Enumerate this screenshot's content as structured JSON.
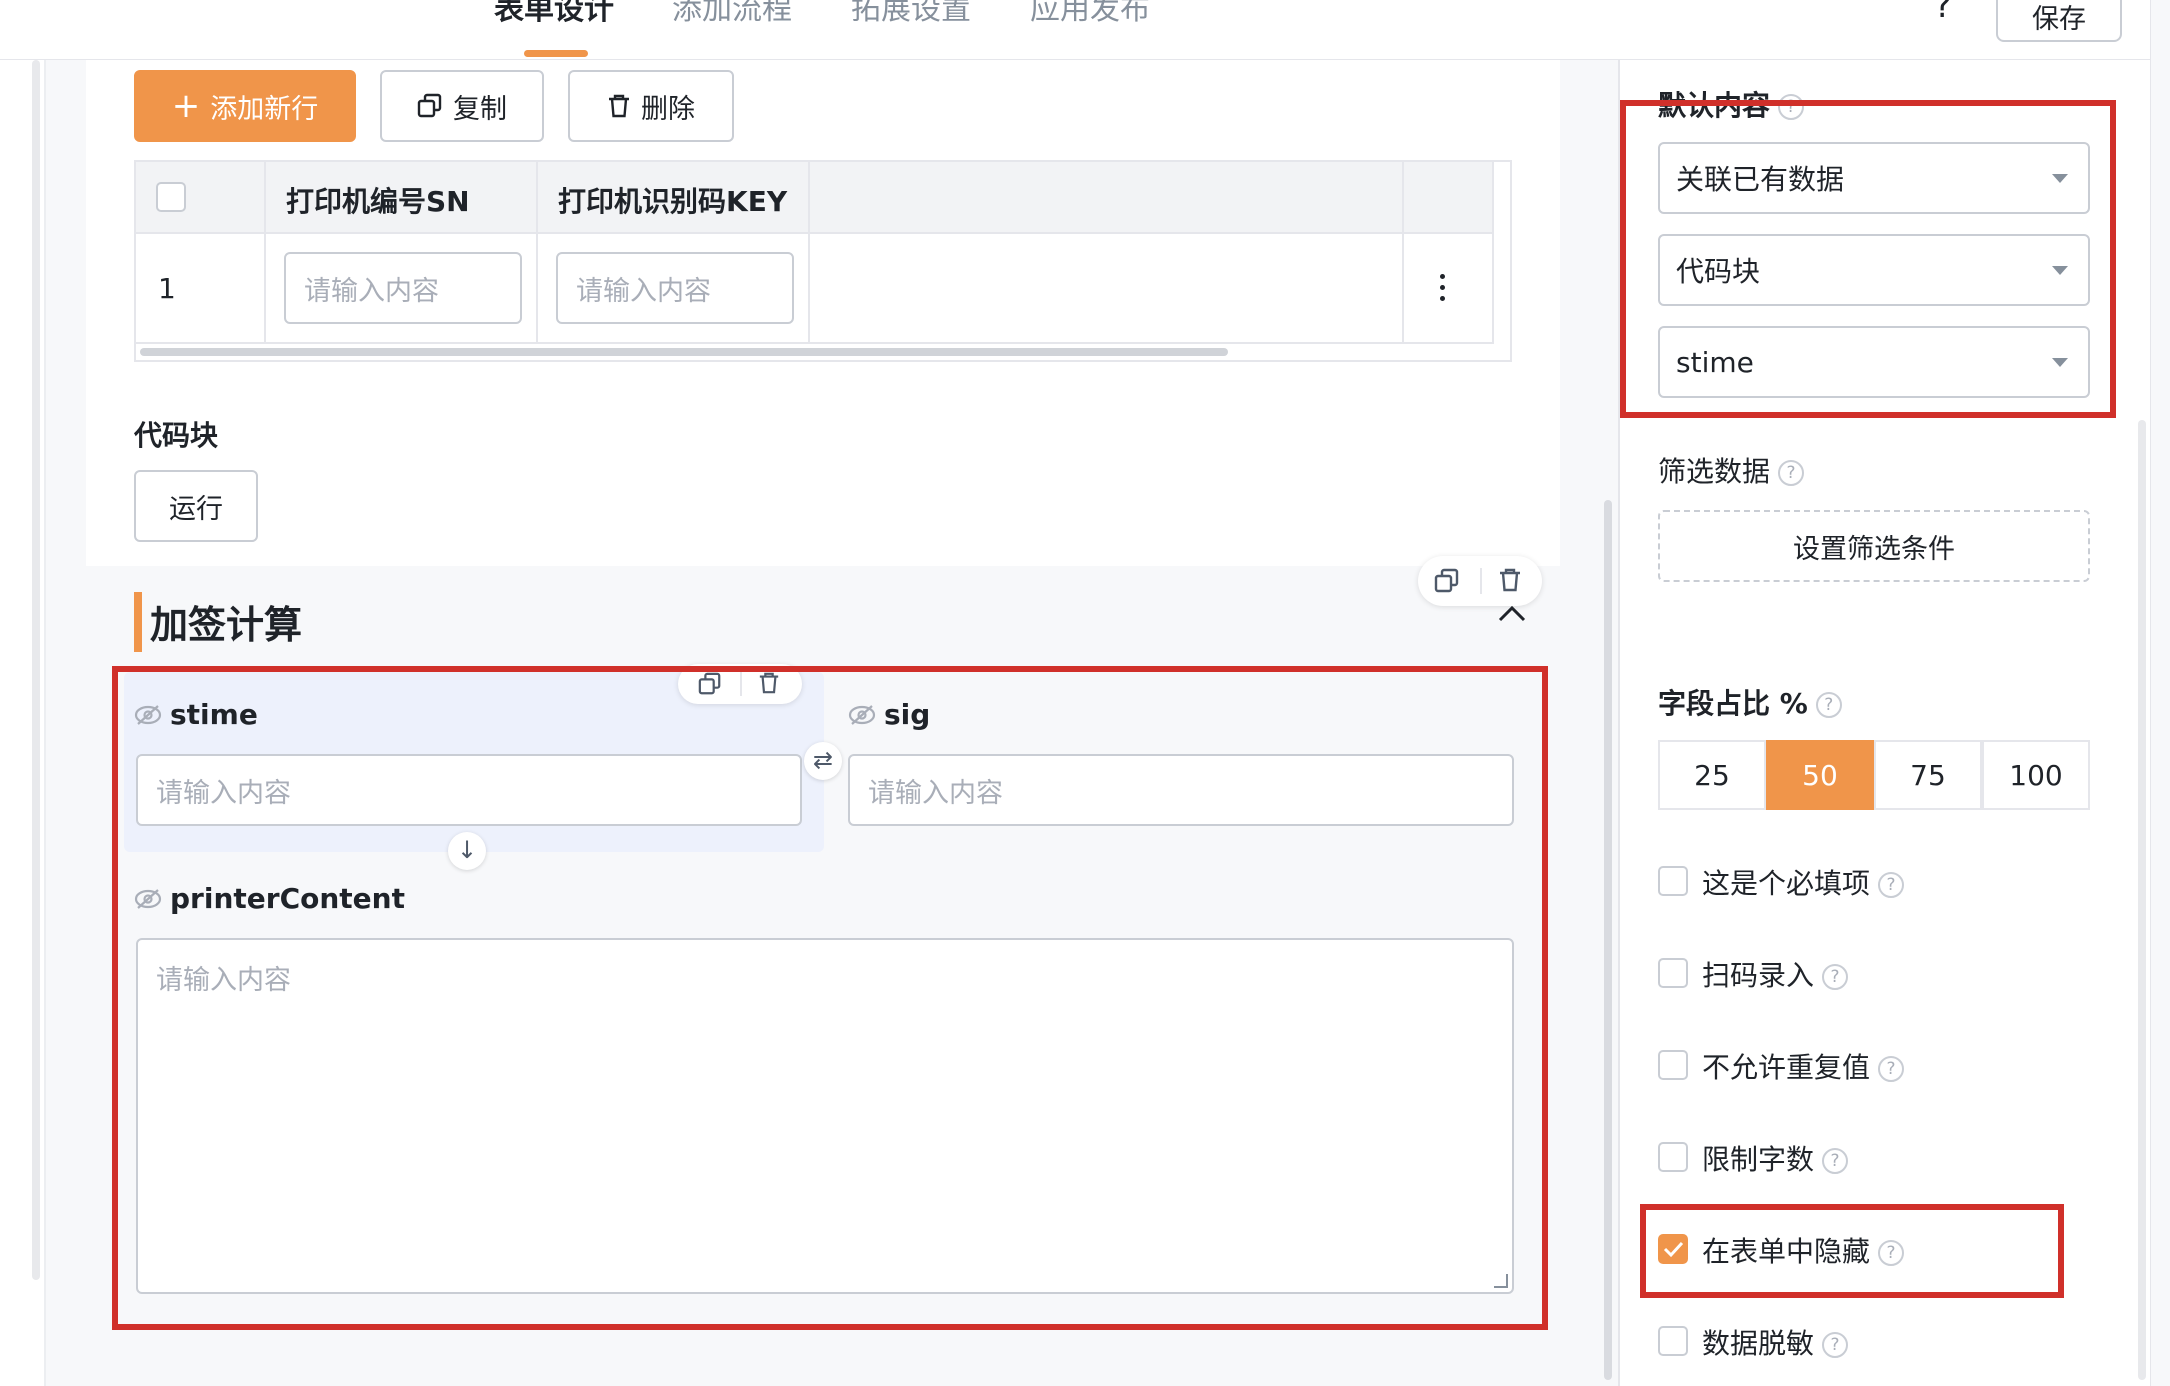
{
  "header": {
    "tabs": [
      {
        "label": "表单设计",
        "active": true
      },
      {
        "label": "添加流程"
      },
      {
        "label": "拓展设置"
      },
      {
        "label": "应用发布"
      }
    ],
    "help_icon": "question-icon",
    "save_label": "保存"
  },
  "toolbar": {
    "add_row_label": "添加新行",
    "copy_label": "复制",
    "delete_label": "删除"
  },
  "table": {
    "columns": [
      "打印机编号SN",
      "打印机识别码KEY"
    ],
    "rows": [
      {
        "index": "1",
        "sn_placeholder": "请输入内容",
        "key_placeholder": "请输入内容"
      }
    ]
  },
  "code_block": {
    "title": "代码块",
    "run_label": "运行"
  },
  "section": {
    "title": "加签计算",
    "fields": [
      {
        "name": "stime",
        "placeholder": "请输入内容"
      },
      {
        "name": "sig",
        "placeholder": "请输入内容"
      },
      {
        "name": "printerContent",
        "placeholder": "请输入内容"
      }
    ]
  },
  "panel": {
    "default_content_label": "默认内容",
    "selects": [
      "关联已有数据",
      "代码块",
      "stime"
    ],
    "filter_label": "筛选数据",
    "filter_button": "设置筛选条件",
    "ratio_label": "字段占比 %",
    "ratio_options": [
      "25",
      "50",
      "75",
      "100"
    ],
    "ratio_selected": "50",
    "checkboxes": [
      {
        "label": "这是个必填项",
        "checked": false
      },
      {
        "label": "扫码录入",
        "checked": false
      },
      {
        "label": "不允许重复值",
        "checked": false
      },
      {
        "label": "限制字数",
        "checked": false
      },
      {
        "label": "在表单中隐藏",
        "checked": true
      },
      {
        "label": "数据脱敏",
        "checked": false
      }
    ]
  },
  "colors": {
    "accent": "#f0954a",
    "highlight_border": "#d0302a"
  }
}
